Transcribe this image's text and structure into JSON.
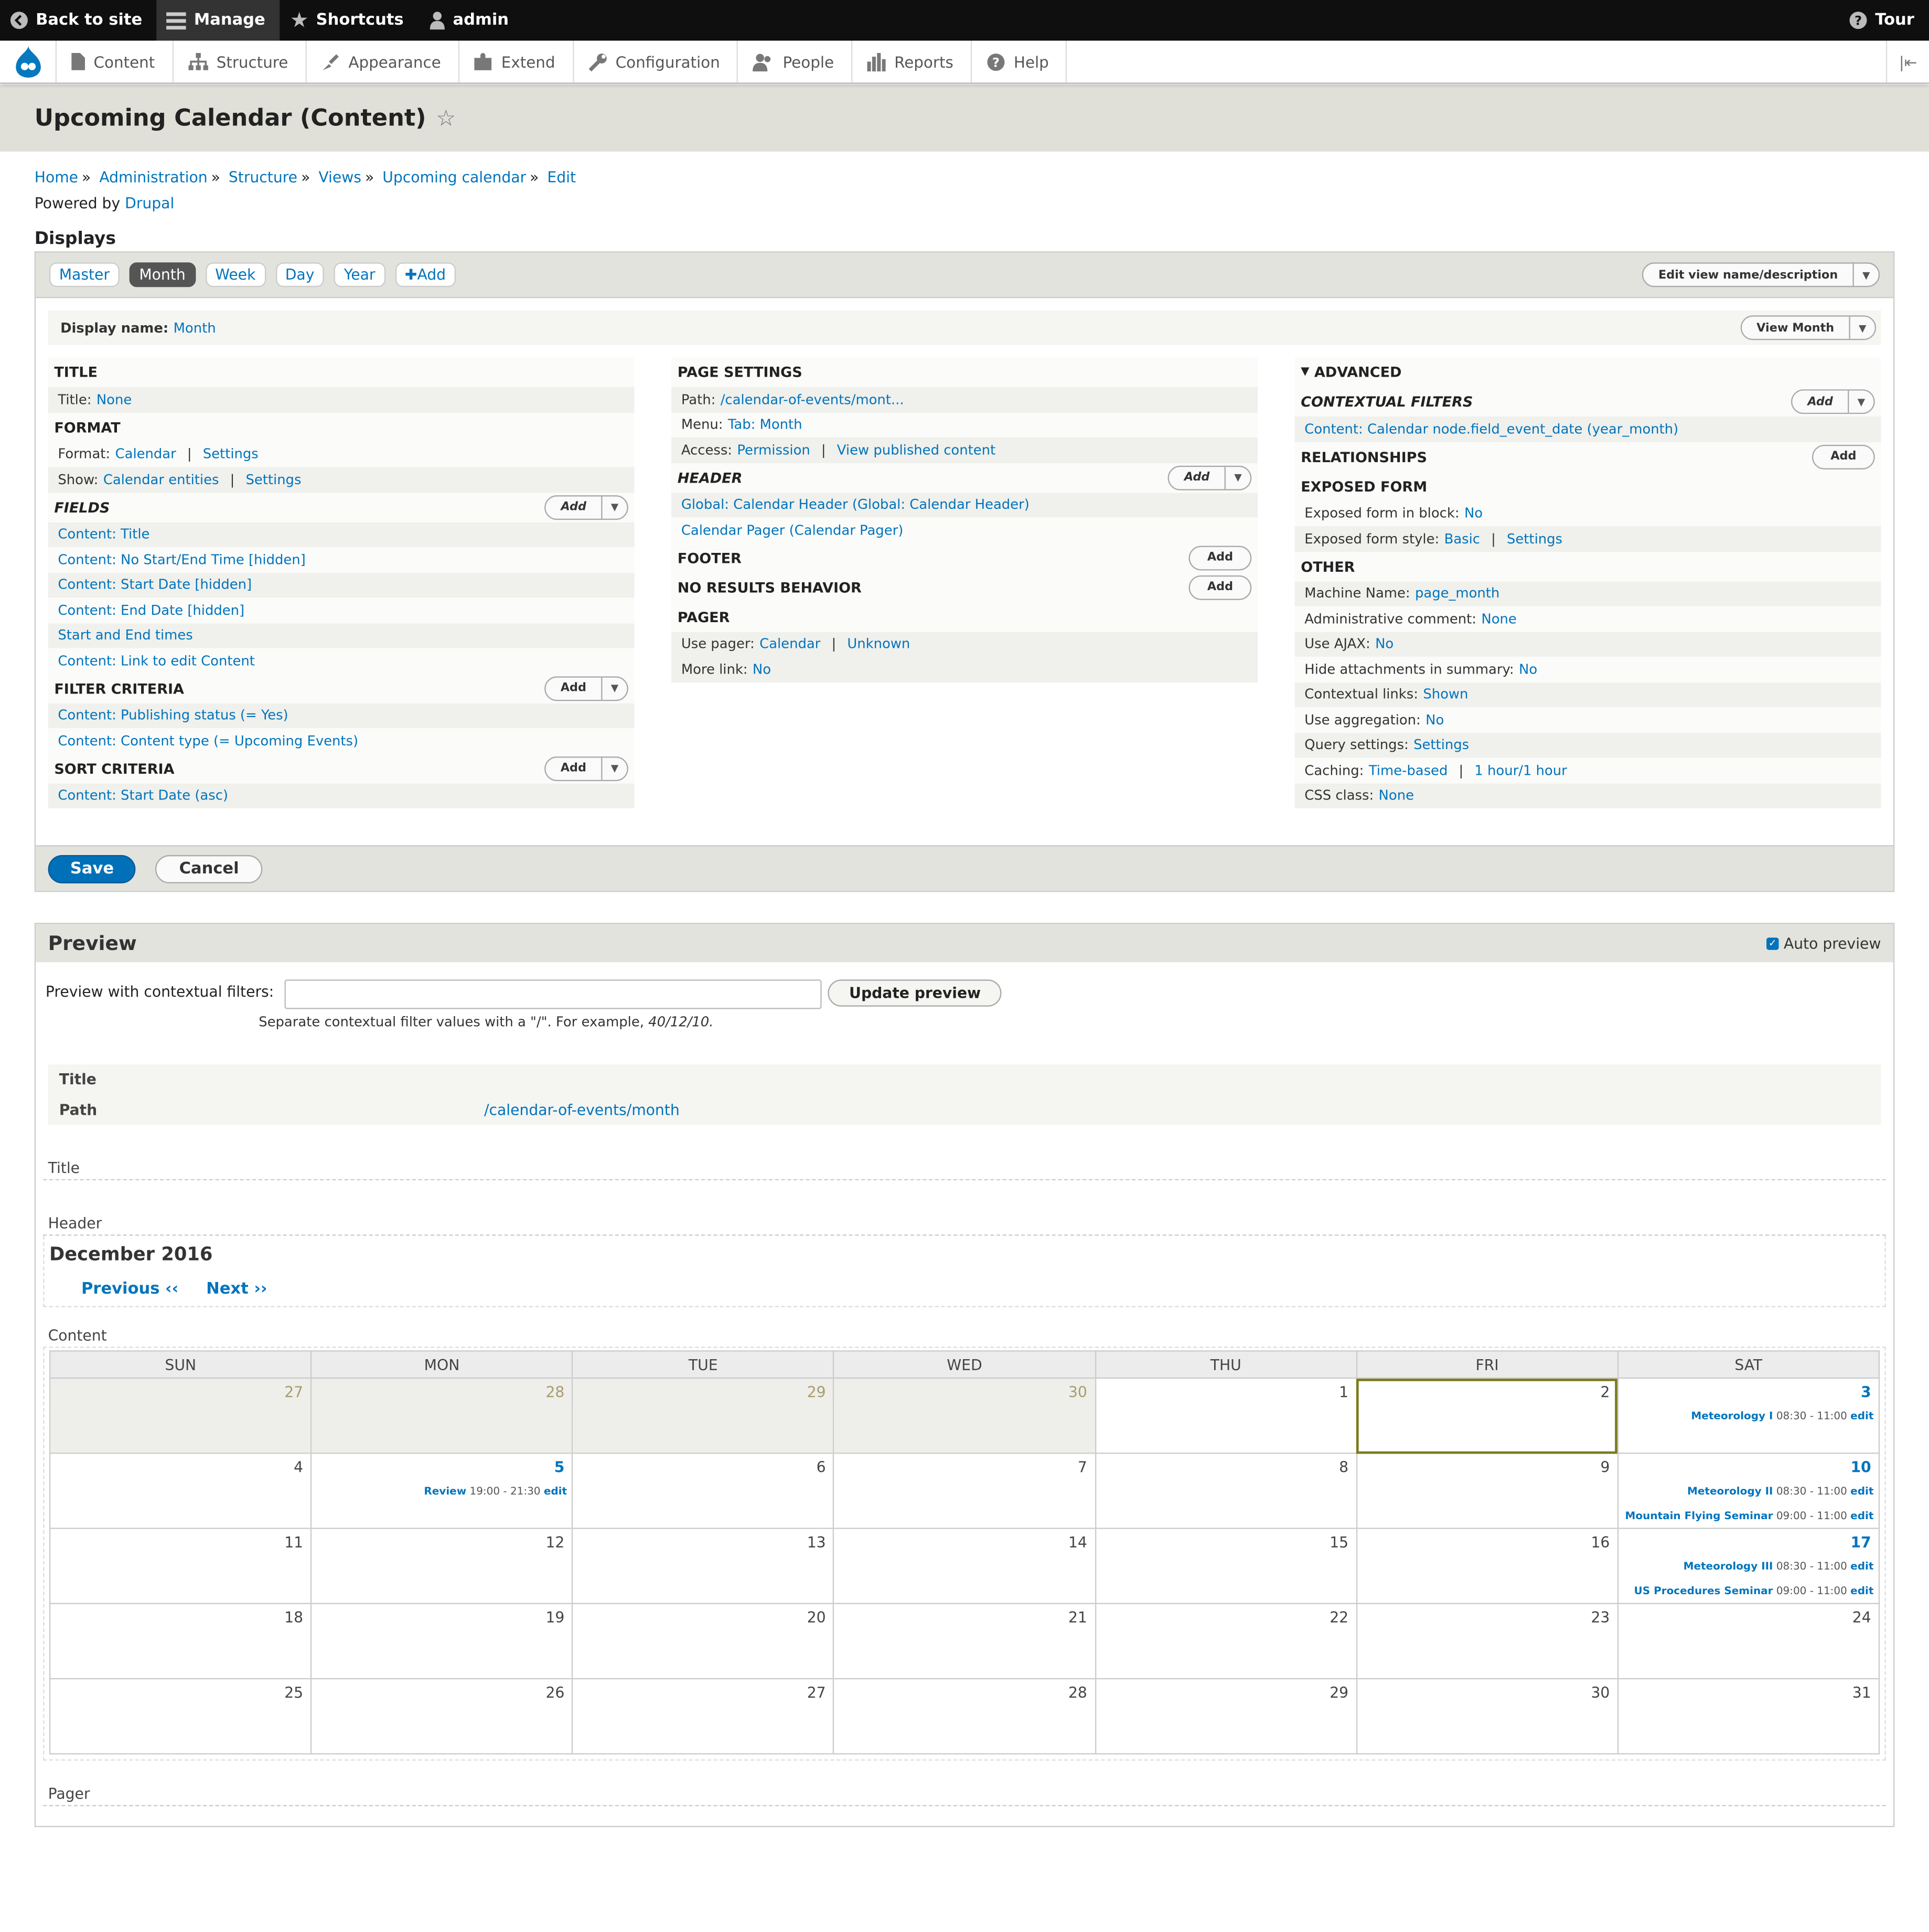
{
  "toolbar": {
    "back": "Back to site",
    "manage": "Manage",
    "shortcuts": "Shortcuts",
    "user": "admin",
    "tour": "Tour"
  },
  "tray": [
    "Content",
    "Structure",
    "Appearance",
    "Extend",
    "Configuration",
    "People",
    "Reports",
    "Help"
  ],
  "page": {
    "title": "Upcoming Calendar (Content)",
    "breadcrumb": [
      "Home",
      "Administration",
      "Structure",
      "Views",
      "Upcoming calendar",
      "Edit"
    ],
    "powered_prefix": "Powered by",
    "powered_link": "Drupal",
    "displays_heading": "Displays"
  },
  "tabs": [
    "Master",
    "Month",
    "Week",
    "Day",
    "Year",
    "Add"
  ],
  "edit_view_btn": "Edit view name/description",
  "display_name_label": "Display name:",
  "display_name": "Month",
  "view_month_btn": "View Month",
  "add_label": "Add",
  "col1": {
    "title_h": "TITLE",
    "title_label": "Title:",
    "title_val": "None",
    "format_h": "FORMAT",
    "format_label": "Format:",
    "format_val": "Calendar",
    "format_settings": "Settings",
    "show_label": "Show:",
    "show_val": "Calendar entities",
    "show_settings": "Settings",
    "fields_h": "FIELDS",
    "fields": [
      "Content: Title",
      "Content: No Start/End Time [hidden]",
      "Content: Start Date [hidden]",
      "Content: End Date [hidden]",
      "Start and End times",
      "Content: Link to edit Content"
    ],
    "filter_h": "FILTER CRITERIA",
    "filters": [
      "Content: Publishing status (= Yes)",
      "Content: Content type (= Upcoming Events)"
    ],
    "sort_h": "SORT CRITERIA",
    "sorts": [
      "Content: Start Date (asc)"
    ]
  },
  "col2": {
    "page_h": "PAGE SETTINGS",
    "path_label": "Path:",
    "path_val": "/calendar-of-events/mont...",
    "menu_label": "Menu:",
    "menu_val": "Tab: Month",
    "access_label": "Access:",
    "access_val": "Permission",
    "access_val2": "View published content",
    "header_h": "HEADER",
    "header_items": [
      "Global: Calendar Header (Global: Calendar Header)",
      "Calendar Pager (Calendar Pager)"
    ],
    "footer_h": "FOOTER",
    "noresults_h": "NO RESULTS BEHAVIOR",
    "pager_h": "PAGER",
    "usepager_label": "Use pager:",
    "usepager_val": "Calendar",
    "usepager_val2": "Unknown",
    "more_label": "More link:",
    "more_val": "No"
  },
  "col3": {
    "advanced_h": "ADVANCED",
    "ctx_h": "CONTEXTUAL FILTERS",
    "ctx_item": "Content: Calendar node.field_event_date (year_month)",
    "rel_h": "RELATIONSHIPS",
    "exposed_h": "EXPOSED FORM",
    "exposed_block_label": "Exposed form in block:",
    "exposed_block_val": "No",
    "exposed_style_label": "Exposed form style:",
    "exposed_style_val": "Basic",
    "exposed_style_settings": "Settings",
    "other_h": "OTHER",
    "other": [
      {
        "label": "Machine Name:",
        "val": "page_month"
      },
      {
        "label": "Administrative comment:",
        "val": "None"
      },
      {
        "label": "Use AJAX:",
        "val": "No"
      },
      {
        "label": "Hide attachments in summary:",
        "val": "No"
      },
      {
        "label": "Contextual links:",
        "val": "Shown"
      },
      {
        "label": "Use aggregation:",
        "val": "No"
      },
      {
        "label": "Query settings:",
        "val": "Settings"
      },
      {
        "label": "Caching:",
        "val": "Time-based",
        "val2": "1 hour/1 hour"
      },
      {
        "label": "CSS class:",
        "val": "None"
      }
    ]
  },
  "actions": {
    "save": "Save",
    "cancel": "Cancel"
  },
  "preview": {
    "heading": "Preview",
    "auto_preview": "Auto preview",
    "ctx_label": "Preview with contextual filters:",
    "ctx_value": "",
    "update_btn": "Update preview",
    "hint": "Separate contextual filter values with a \"/\". For example,",
    "hint_example": "40/12/10.",
    "info_title_label": "Title",
    "info_path_label": "Path",
    "info_path_val": "/calendar-of-events/month",
    "area_title": "Title",
    "area_header": "Header",
    "month_title": "December 2016",
    "prev": "Previous ‹‹",
    "next": "Next ››",
    "area_content": "Content",
    "area_pager": "Pager"
  },
  "calendar": {
    "days": [
      "SUN",
      "MON",
      "TUE",
      "WED",
      "THU",
      "FRI",
      "SAT"
    ],
    "weeks": [
      [
        {
          "d": "27",
          "prev": true
        },
        {
          "d": "28",
          "prev": true
        },
        {
          "d": "29",
          "prev": true
        },
        {
          "d": "30",
          "prev": true
        },
        {
          "d": "1"
        },
        {
          "d": "2",
          "today": true
        },
        {
          "d": "3",
          "events": [
            {
              "t": "Meteorology I",
              "time": "08:30 - 11:00",
              "e": "edit"
            }
          ]
        }
      ],
      [
        {
          "d": "4"
        },
        {
          "d": "5",
          "events": [
            {
              "t": "Review",
              "time": "19:00 - 21:30",
              "e": "edit"
            }
          ]
        },
        {
          "d": "6"
        },
        {
          "d": "7"
        },
        {
          "d": "8"
        },
        {
          "d": "9"
        },
        {
          "d": "10",
          "events": [
            {
              "t": "Meteorology II",
              "time": "08:30 - 11:00",
              "e": "edit"
            },
            {
              "t": "Mountain Flying Seminar",
              "time": "09:00 - 11:00",
              "e": "edit"
            }
          ]
        }
      ],
      [
        {
          "d": "11"
        },
        {
          "d": "12"
        },
        {
          "d": "13"
        },
        {
          "d": "14"
        },
        {
          "d": "15"
        },
        {
          "d": "16"
        },
        {
          "d": "17",
          "events": [
            {
              "t": "Meteorology III",
              "time": "08:30 - 11:00",
              "e": "edit"
            },
            {
              "t": "US Procedures Seminar",
              "time": "09:00 - 11:00",
              "e": "edit"
            }
          ]
        }
      ],
      [
        {
          "d": "18"
        },
        {
          "d": "19"
        },
        {
          "d": "20"
        },
        {
          "d": "21"
        },
        {
          "d": "22"
        },
        {
          "d": "23"
        },
        {
          "d": "24"
        }
      ],
      [
        {
          "d": "25"
        },
        {
          "d": "26"
        },
        {
          "d": "27"
        },
        {
          "d": "28"
        },
        {
          "d": "29"
        },
        {
          "d": "30"
        },
        {
          "d": "31"
        }
      ]
    ]
  },
  "colors": {
    "link": "#0074bd",
    "toolbar": "#0f0f0f",
    "save": "#0071b8",
    "today_outline": "#7b7b1e"
  }
}
